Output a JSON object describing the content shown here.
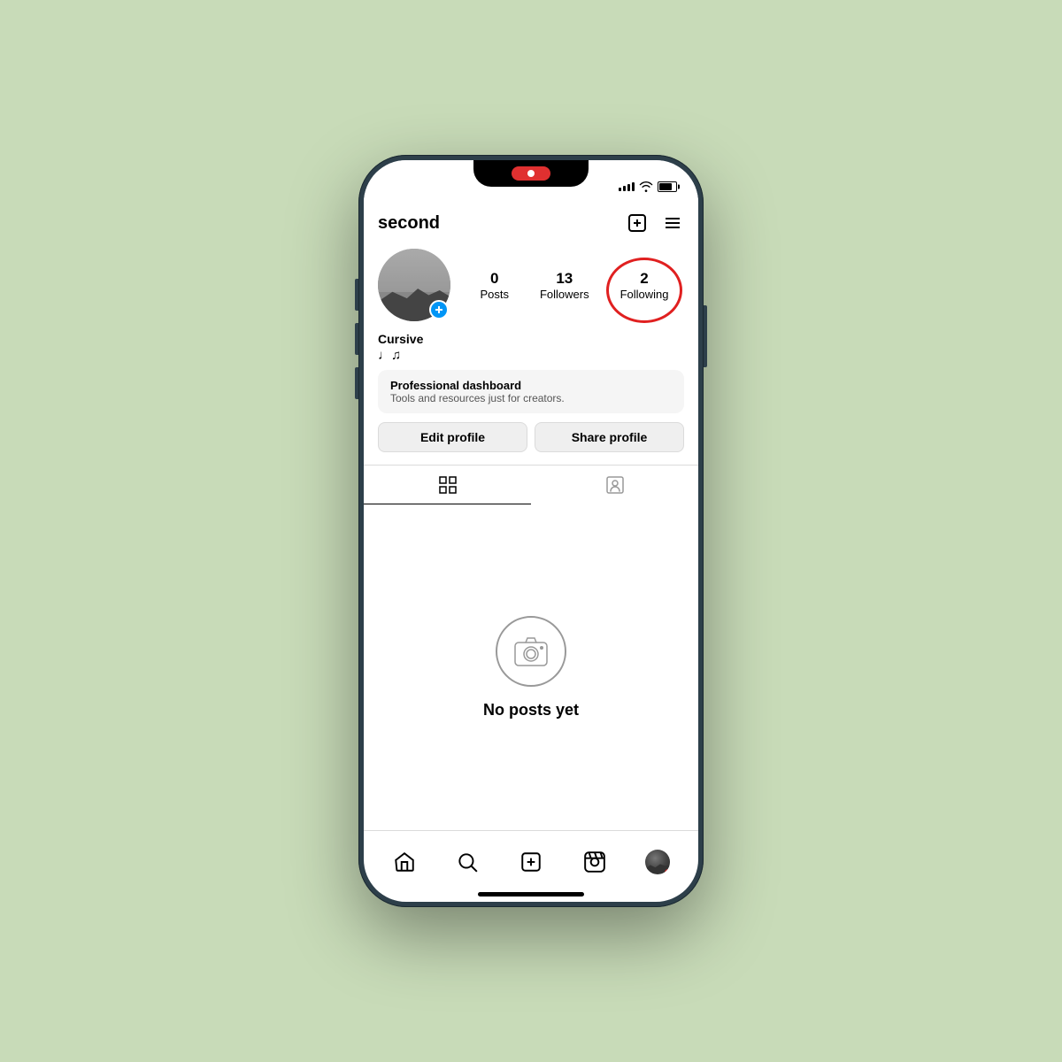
{
  "background": "#c8dbb8",
  "phone": {
    "statusBar": {
      "recordIndicator": "recording",
      "signal": "signal-icon",
      "wifi": "wifi-icon",
      "battery": "battery-icon"
    },
    "topNav": {
      "username": "second",
      "addIcon": "plus-square-icon",
      "menuIcon": "menu-icon"
    },
    "profile": {
      "stats": {
        "posts": {
          "count": "0",
          "label": "Posts"
        },
        "followers": {
          "count": "13",
          "label": "Followers"
        },
        "following": {
          "count": "2",
          "label": "Following"
        }
      },
      "name": "Cursive",
      "bio": "♩♫",
      "proDashboard": {
        "title": "Professional dashboard",
        "subtitle": "Tools and resources just for creators."
      },
      "editButton": "Edit profile",
      "shareButton": "Share profile"
    },
    "tabs": {
      "grid": "grid-icon",
      "tagged": "person-tag-icon"
    },
    "emptyState": {
      "icon": "camera-icon",
      "text": "No posts yet"
    },
    "bottomNav": {
      "home": "home-icon",
      "search": "search-icon",
      "add": "plus-square-icon",
      "reels": "reels-icon",
      "profile": "profile-icon"
    }
  }
}
